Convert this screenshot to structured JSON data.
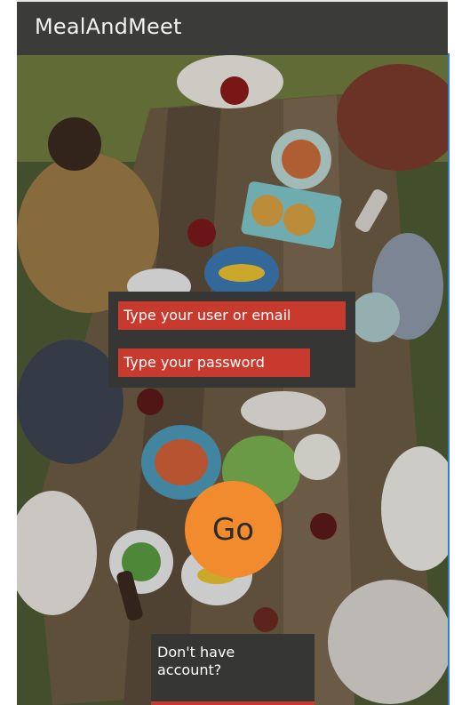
{
  "app": {
    "title": "MealAndMeet"
  },
  "login": {
    "user_placeholder": "Type your user or email",
    "password_placeholder": "Type your password",
    "go_label": "Go"
  },
  "signup": {
    "prompt": "Don't have account?"
  },
  "colors": {
    "appbar": "#3b3b39",
    "field": "#c8392e",
    "go_button": "#f28a2e",
    "panel": "#363634"
  }
}
